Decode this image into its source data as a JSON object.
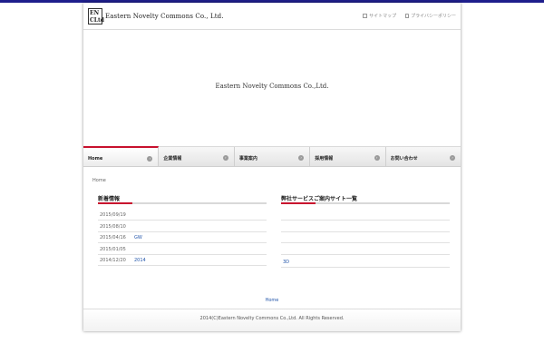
{
  "header": {
    "logo_line1": "EN",
    "logo_line2": "CLtd",
    "company_name": "Eastern Novelty Commons Co., Ltd.",
    "links": [
      "サイトマップ",
      "プライバシーポリシー"
    ]
  },
  "hero": {
    "text": "Eastern Novelty Commons Co.,Ltd."
  },
  "nav": {
    "items": [
      {
        "label": "Home",
        "active": true
      },
      {
        "label": "企業情報",
        "active": false
      },
      {
        "label": "事業案内",
        "active": false
      },
      {
        "label": "採用情報",
        "active": false
      },
      {
        "label": "お問い合わせ",
        "active": false
      }
    ],
    "dot_glyph": "›"
  },
  "breadcrumb": "Home",
  "news": {
    "title": "新着情報",
    "items": [
      {
        "date": "2015/09/19",
        "title": ""
      },
      {
        "date": "2015/08/10",
        "title": ""
      },
      {
        "date": "2015/04/16",
        "title": "GW"
      },
      {
        "date": "2015/01/05",
        "title": ""
      },
      {
        "date": "2014/12/20",
        "title": "2014"
      }
    ]
  },
  "services": {
    "title": "弊社サービスご案内サイト一覧",
    "items": [
      {
        "title": ""
      },
      {
        "title": ""
      },
      {
        "title": ""
      },
      {
        "title": ""
      },
      {
        "title": "3D"
      }
    ]
  },
  "footer": {
    "home_link": "Home",
    "copyright": "2014(C)Eastern Novelty Commons Co.,Ltd. All Rights Reserved."
  },
  "colors": {
    "accent_red": "#c8102e",
    "top_bar": "#1e1e8c",
    "link_blue": "#2255aa"
  }
}
